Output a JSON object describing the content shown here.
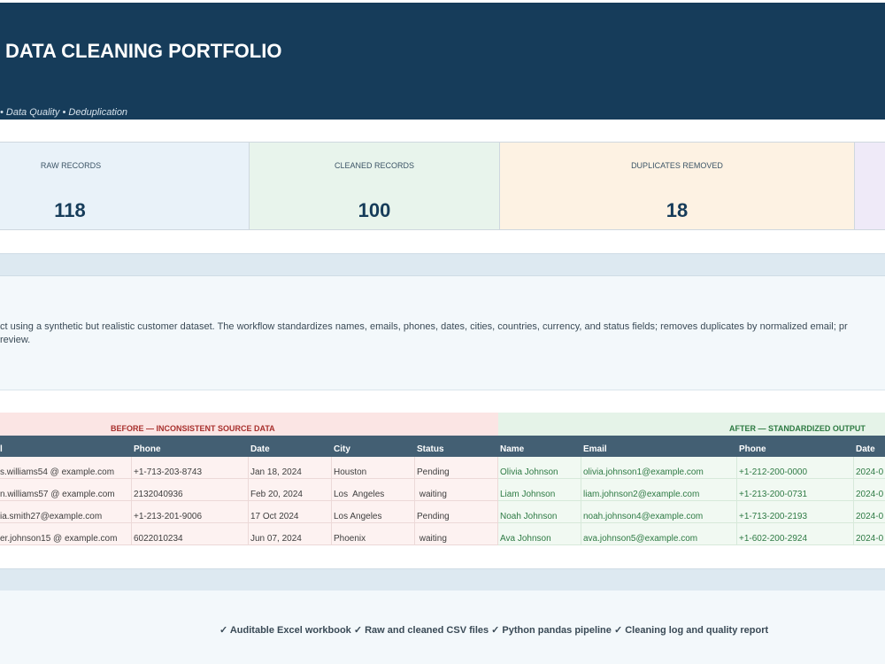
{
  "header": {
    "title": "DATA CLEANING PORTFOLIO",
    "subtitle": "• Data Quality • Deduplication",
    "background": "#163c5a"
  },
  "kpis": [
    {
      "label": "RAW RECORDS",
      "value": "118",
      "color": "#e9f2f9"
    },
    {
      "label": "CLEANED RECORDS",
      "value": "100",
      "color": "#e8f4ec"
    },
    {
      "label": "DUPLICATES REMOVED",
      "value": "18",
      "color": "#fdf2e3"
    },
    {
      "label": "",
      "value": "",
      "color": "#efeaf8"
    }
  ],
  "description": {
    "line1": "ct using a synthetic but realistic customer dataset. The workflow standardizes names, emails, phones, dates, cities, countries, currency, and status fields; removes duplicates by normalized email; pr",
    "line2": "review."
  },
  "comparison": {
    "before_title": "BEFORE — INCONSISTENT SOURCE DATA",
    "after_title": "AFTER — STANDARDIZED OUTPUT",
    "before_columns": [
      "l",
      "Phone",
      "Date",
      "City",
      "Status"
    ],
    "after_columns": [
      "Name",
      "Email",
      "Phone",
      "Date"
    ],
    "rows": [
      {
        "before": [
          "s.williams54 @ example.com",
          "+1-713-203-8743",
          "Jan 18, 2024",
          "Houston",
          "Pending"
        ],
        "after": [
          "Olivia Johnson",
          "olivia.johnson1@example.com",
          "+1-212-200-0000",
          "2024-0"
        ]
      },
      {
        "before": [
          "n.williams57 @ example.com",
          "2132040936",
          "Feb 20, 2024",
          "Los  Angeles",
          " waiting"
        ],
        "after": [
          "Liam Johnson",
          "liam.johnson2@example.com",
          "+1-213-200-0731",
          "2024-0"
        ]
      },
      {
        "before": [
          "ia.smith27@example.com",
          "+1-213-201-9006",
          "17 Oct 2024",
          "Los Angeles",
          "Pending"
        ],
        "after": [
          "Noah Johnson",
          "noah.johnson4@example.com",
          "+1-713-200-2193",
          "2024-0"
        ]
      },
      {
        "before": [
          "er.johnson15 @ example.com",
          "6022010234",
          "Jun 07, 2024",
          "Phoenix",
          " waiting"
        ],
        "after": [
          "Ava Johnson",
          "ava.johnson5@example.com",
          "+1-602-200-2924",
          "2024-0"
        ]
      }
    ]
  },
  "footer": {
    "features": "✓ Auditable Excel workbook  ✓ Raw and cleaned CSV files  ✓ Python pandas pipeline  ✓ Cleaning log and quality report"
  }
}
